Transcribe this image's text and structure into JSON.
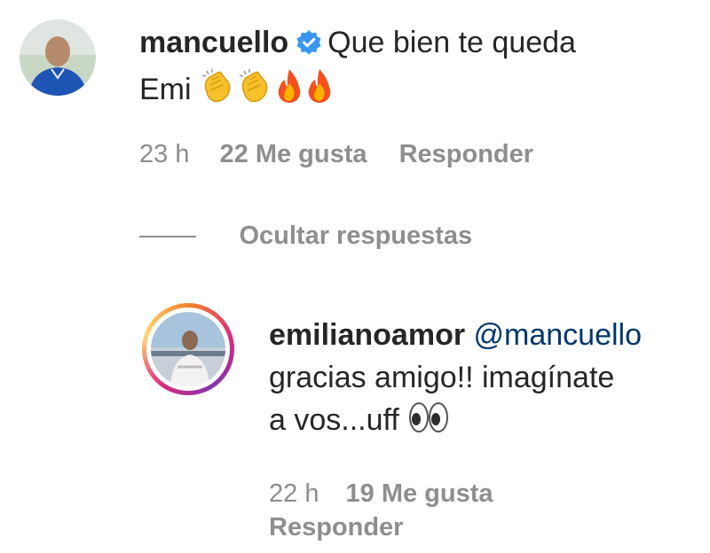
{
  "comment": {
    "username": "mancuello",
    "verified": true,
    "text_line1": "Que bien te queda",
    "text_line2": "Emi",
    "emoji": [
      "clapping-hands",
      "clapping-hands",
      "fire",
      "fire"
    ],
    "time": "23 h",
    "likes": "22 Me gusta",
    "reply": "Responder"
  },
  "toggle_replies": "Ocultar respuestas",
  "reply": {
    "username": "emilianoamor",
    "mention": "@mancuello",
    "text_line1": "gracias amigo!! imagínate",
    "text_line2": "a vos...uff",
    "emoji": [
      "eyes"
    ],
    "time": "22 h",
    "likes": "19 Me gusta",
    "reply": "Responder"
  },
  "colors": {
    "text": "#262626",
    "muted": "#8e8e8e",
    "mention": "#00376b",
    "verified": "#3897f0",
    "story_ring": "#e1306c"
  }
}
